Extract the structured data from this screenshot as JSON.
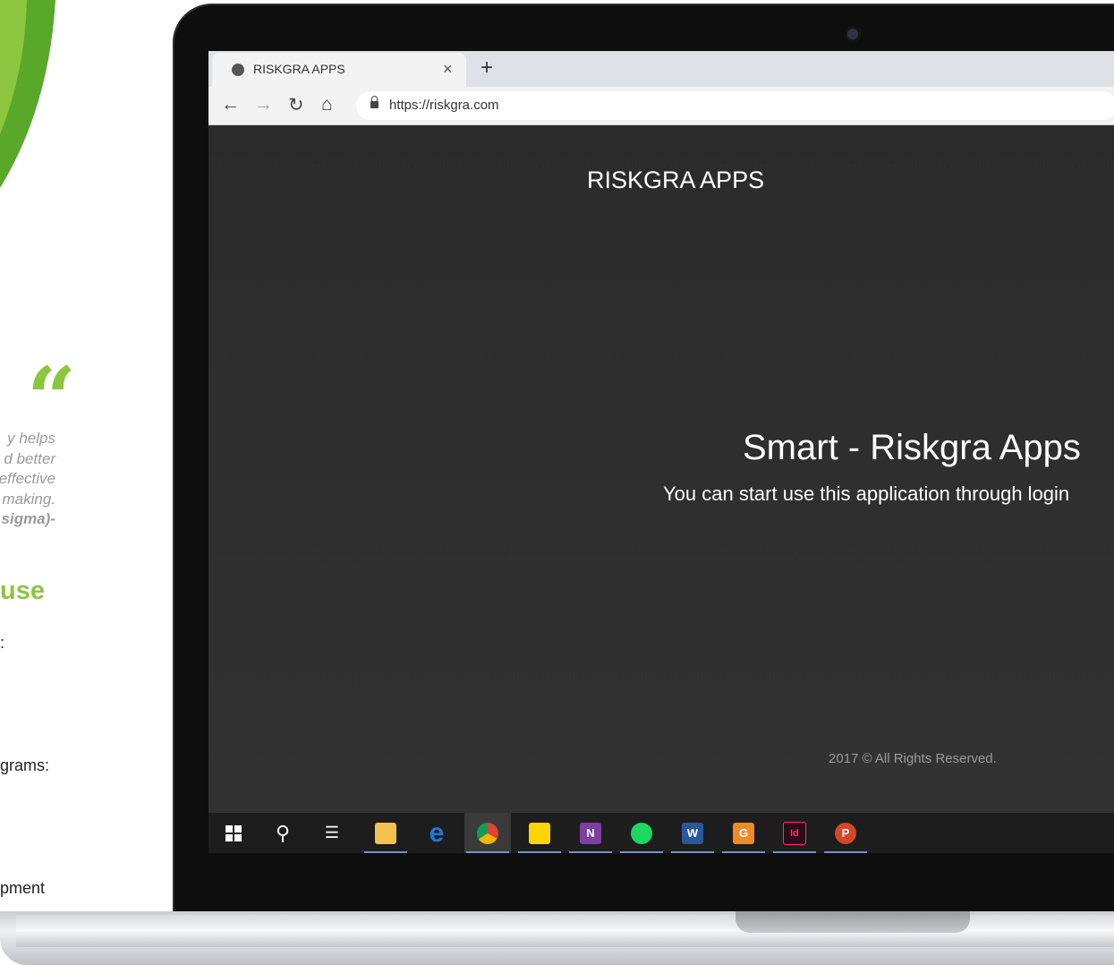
{
  "left_column": {
    "quote_lines": [
      "y helps",
      "d better",
      "effective",
      "making.",
      "sigma)-"
    ],
    "section_heading": "use",
    "fragments": [
      ":",
      "grams:",
      "pment"
    ]
  },
  "browser": {
    "tab_title": "RISKGRA APPS",
    "tab_close": "×",
    "new_tab": "+",
    "url": "https://riskgra.com",
    "nav": {
      "back": "←",
      "forward": "→",
      "reload": "↻",
      "home": "⌂"
    }
  },
  "page": {
    "brand": "RISKGRA APPS",
    "hero_title": "Smart - Riskgra Apps",
    "hero_subtitle": "You can start use this application through login",
    "footer": "2017 © All Rights Reserved."
  },
  "taskbar": {
    "items": [
      {
        "name": "start-button",
        "icon": "windows-icon"
      },
      {
        "name": "search-button",
        "icon": "search-icon",
        "glyph": "⚲"
      },
      {
        "name": "task-view-button",
        "icon": "task-view-icon",
        "glyph": "☰"
      },
      {
        "name": "file-explorer",
        "icon": "folder-icon"
      },
      {
        "name": "edge",
        "icon": "edge-icon",
        "glyph": "e"
      },
      {
        "name": "chrome",
        "icon": "chrome-icon"
      },
      {
        "name": "sticky-notes",
        "icon": "sticky-notes-icon"
      },
      {
        "name": "onenote",
        "icon": "onenote-icon",
        "glyph": "N"
      },
      {
        "name": "spotify",
        "icon": "spotify-icon"
      },
      {
        "name": "word",
        "icon": "word-icon",
        "glyph": "W"
      },
      {
        "name": "foxit",
        "icon": "foxit-icon",
        "glyph": "G"
      },
      {
        "name": "indesign",
        "icon": "indesign-icon",
        "glyph": "Id"
      },
      {
        "name": "powerpoint",
        "icon": "powerpoint-icon",
        "glyph": "P"
      }
    ]
  },
  "colors": {
    "accent_green": "#8cc63f",
    "page_bg": "#2e2e2e",
    "taskbar_bg": "#1d1d1d"
  }
}
